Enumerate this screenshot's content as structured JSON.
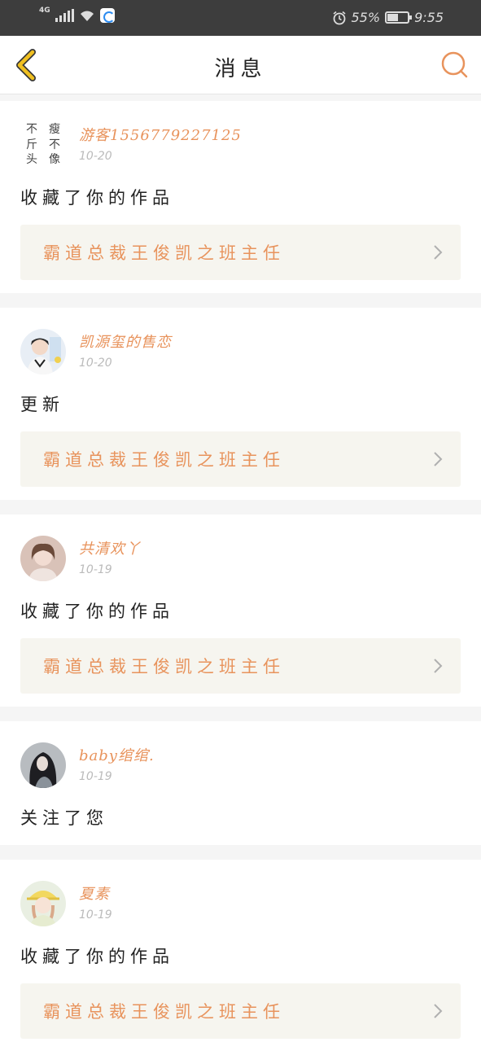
{
  "status_bar": {
    "network": "4G",
    "battery": "55%",
    "battery_level": 0.55,
    "time": "9:55"
  },
  "header": {
    "title": "消息",
    "back_icon": "back-chevron-icon",
    "search_icon": "search-icon"
  },
  "colors": {
    "accent": "#e8935c",
    "back_icon": "#f0c020",
    "card_bg": "#f6f5ef"
  },
  "notifications": [
    {
      "username": "游客15567792271​25",
      "time": "10-20",
      "message": "收藏了你的作品",
      "work_title": "霸道总裁王俊凯之班主任",
      "avatar_text": [
        "不",
        "瘦",
        "斤",
        "不",
        "头",
        "像"
      ]
    },
    {
      "username": "凯源玺的售恋",
      "time": "10-20",
      "message": "更新",
      "work_title": "霸道总裁王俊凯之班主任"
    },
    {
      "username": "共清欢丫",
      "time": "10-19",
      "message": "收藏了你的作品",
      "work_title": "霸道总裁王俊凯之班主任"
    },
    {
      "username": "baby绾绾.",
      "time": "10-19",
      "message": "关注了您"
    },
    {
      "username": "夏素",
      "time": "10-19",
      "message": "收藏了你的作品",
      "work_title": "霸道总裁王俊凯之班主任"
    }
  ]
}
